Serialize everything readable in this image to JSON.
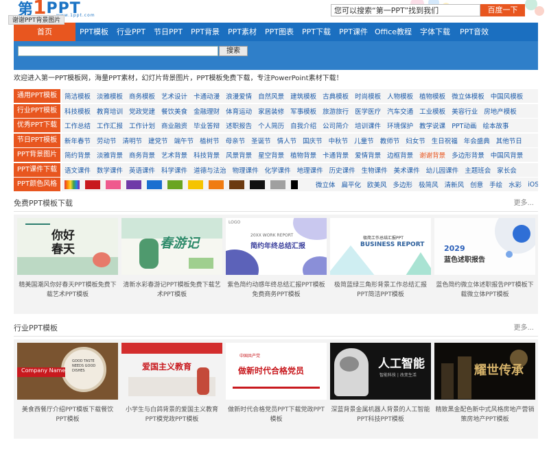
{
  "header": {
    "logo_cn": "第",
    "logo_num": "1",
    "logo_en": "PPT",
    "logo_url": "www.1ppt.com",
    "tooltip": "谢谢PPT背景图片",
    "search_placeholder": "您可以搜索“第一PPT”找到我们",
    "search_button": "百度一下"
  },
  "nav": [
    "首页",
    "PPT模板",
    "行业PPT",
    "节日PPT",
    "PPT背景",
    "PPT素材",
    "PPT图表",
    "PPT下载",
    "PPT课件",
    "Office教程",
    "字体下载",
    "PPT音效"
  ],
  "band_search_button": "搜索",
  "welcome": "欢迎进入第一PPT模板网，海量PPT素材，幻灯片背景图片，PPT模板免费下载，专注PowerPoint素材下载！",
  "categories": [
    {
      "label": "通用PPT模板",
      "links": [
        "简洁模板",
        "淡雅模板",
        "商务模板",
        "艺术设计",
        "卡通动漫",
        "浪漫爱情",
        "自然风景",
        "建筑模板",
        "古典模板",
        "时尚模板",
        "人物模板",
        "植物模板",
        "微立体模板",
        "中国风模板"
      ]
    },
    {
      "label": "行业PPT模板",
      "links": [
        "科技模板",
        "教育培训",
        "党政党建",
        "餐饮美食",
        "金融理财",
        "体育运动",
        "家居装修",
        "军事模板",
        "旅游旅行",
        "医学医疗",
        "汽车交通",
        "工业模板",
        "美容行业",
        "房地产模板"
      ]
    },
    {
      "label": "优秀PPT下载",
      "links": [
        "工作总结",
        "工作汇报",
        "工作计划",
        "商业融资",
        "毕业答辩",
        "述职报告",
        "个人简历",
        "自我介绍",
        "公司简介",
        "培训课件",
        "环境保护",
        "教学说课",
        "PPT动画",
        "绘本故事"
      ]
    },
    {
      "label": "节日PPT模板",
      "links": [
        "新年春节",
        "劳动节",
        "清明节",
        "建党节",
        "端午节",
        "植树节",
        "母亲节",
        "圣诞节",
        "情人节",
        "国庆节",
        "中秋节",
        "儿童节",
        "教师节",
        "妇女节",
        "生日祝福",
        "年会盛典",
        "其他节日"
      ]
    },
    {
      "label": "PPT背景图片",
      "links": [
        "简约背景",
        "淡雅背景",
        "商务背景",
        "艺术背景",
        "科技背景",
        "风景背景",
        "星空背景",
        "植物背景",
        "卡通背景",
        "爱情背景",
        "边框背景",
        "谢谢背景",
        "多边形背景",
        "中国风背景"
      ],
      "highlight": "谢谢背景"
    },
    {
      "label": "PPT课件下载",
      "links": [
        "语文课件",
        "数学课件",
        "英语课件",
        "科学课件",
        "道德与法治",
        "物理课件",
        "化学课件",
        "地理课件",
        "历史课件",
        "生物课件",
        "美术课件",
        "幼儿园课件",
        "主题班会",
        "家长会"
      ]
    },
    {
      "label": "PPT颜色风格",
      "links": [
        "微立体",
        "扁平化",
        "欧美风",
        "多边形",
        "极简风",
        "清新风",
        "创意",
        "手绘",
        "水彩",
        "iOS"
      ],
      "colors": [
        "rainbow",
        "#c8191e",
        "#ef5a8e",
        "#6f3aa8",
        "#1a6fd0",
        "#6aa521",
        "#f5c400",
        "#f07c12",
        "#6b3a10",
        "#111111",
        "#a0a0a0",
        "#000000"
      ]
    }
  ],
  "sections": [
    {
      "title": "免费PPT模板下载",
      "more": "更多...",
      "cards": [
        {
          "caption": "精美国潮风你好春天PPT模板免费下载艺术PPT模板",
          "thumb_text": "你好春天"
        },
        {
          "caption": "清新水彩春游记PPT模板免费下载艺术PPT模板",
          "thumb_text": "春游记"
        },
        {
          "caption": "紫色简约动感年终总结汇报PPT模板免费商务PPT模板",
          "thumb_text": "简约年终总结汇报",
          "thumb_sub": "20XX WORK REPORT",
          "thumb_logo": "LOGO"
        },
        {
          "caption": "极简蓝绿三角形背景工作总结汇报PPT简洁PPT模板",
          "thumb_text": "BUSINESS REPORT",
          "thumb_sub": "极简工作总结汇报PPT"
        },
        {
          "caption": "蓝色简约微立体述职报告PPT模板下载微立体PPT模板",
          "thumb_text": "蓝色述职报告",
          "thumb_sub": "2029"
        }
      ]
    },
    {
      "title": "行业PPT模板",
      "more": "更多...",
      "cards": [
        {
          "caption": "美食西餐厅介绍PPT模板下载餐饮PPT模板",
          "thumb_text": "Company Name",
          "thumb_sub": "GOOD TASTE NEEDS GOOD DISHES"
        },
        {
          "caption": "小学生与白鸽背景的爱国主义教育PPT模党政PPT模板",
          "thumb_text": "爱国主义教育"
        },
        {
          "caption": "做新时代合格党员PPT下载党政PPT模板",
          "thumb_text": "做新时代合格党员",
          "thumb_sub": "中国共产党"
        },
        {
          "caption": "深蓝背景金属机器人背景的人工智能PPT科技PPT模板",
          "thumb_text": "人工智能",
          "thumb_sub": "智能科技 | 改变生活"
        },
        {
          "caption": "精致黑金配色新中式风格房地产营销策房地产PPT模板",
          "thumb_text": "耀世传承"
        }
      ]
    }
  ]
}
